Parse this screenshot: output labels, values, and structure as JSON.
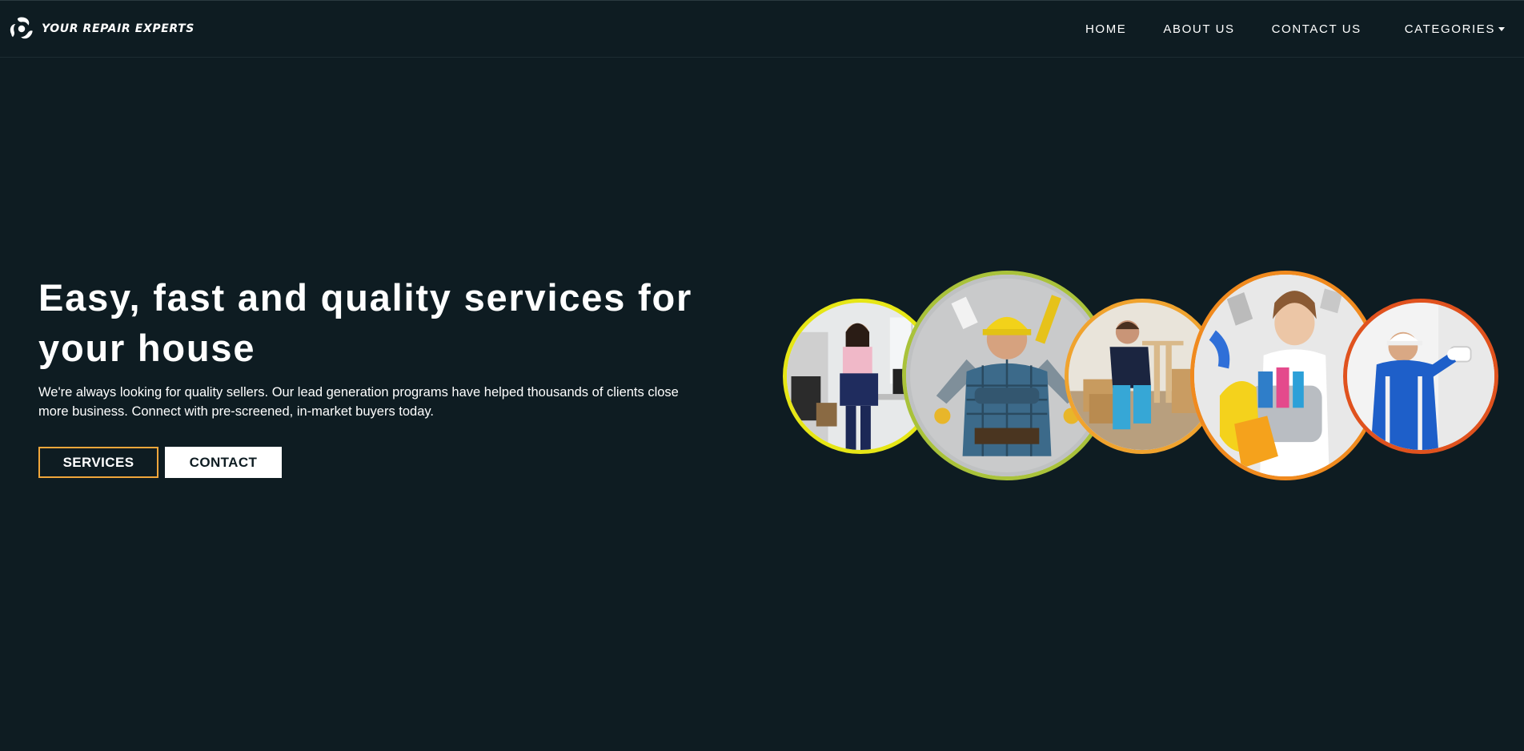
{
  "brand": {
    "name": "YOUR REPAIR EXPERTS",
    "logo_icon": "swirl-logo-icon"
  },
  "nav": {
    "items": [
      {
        "label": "HOME"
      },
      {
        "label": "ABOUT US"
      },
      {
        "label": "CONTACT US"
      },
      {
        "label": "CATEGORIES"
      }
    ]
  },
  "hero": {
    "title": "Easy, fast and quality services for your house",
    "description": "We're always looking for quality sellers. Our lead generation programs have helped thousands of clients close more business. Connect with pre-screened, in-market buyers today.",
    "services_button": "SERVICES",
    "contact_button": "CONTACT"
  },
  "colors": {
    "background": "#0e1c22",
    "accent": "#f0a63b",
    "circle_borders": [
      "#e6e616",
      "#a9c23a",
      "#f0a32e",
      "#f08a1e",
      "#e0521e"
    ]
  }
}
